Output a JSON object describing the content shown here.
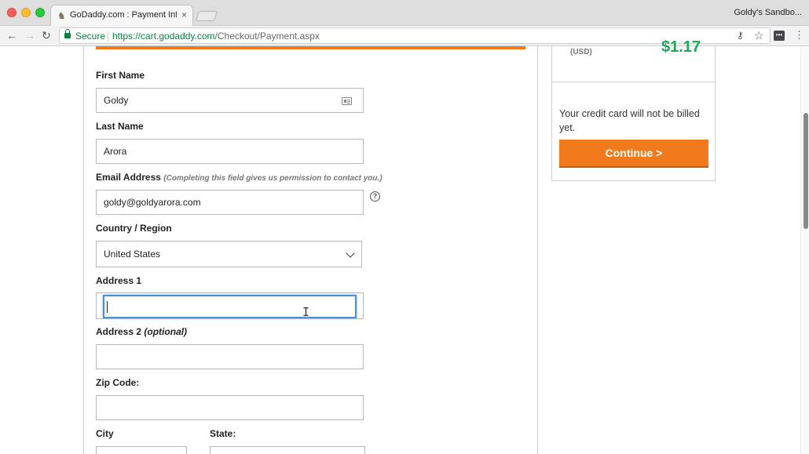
{
  "browser": {
    "tab_title": "GoDaddy.com : Payment Information",
    "tab_close": "×",
    "profile_name": "Goldy's Sandbo...",
    "secure_label": "Secure",
    "url_host": "https://cart.godaddy.com",
    "url_path": "/Checkout/Payment.aspx",
    "back_icon": "←",
    "forward_icon": "→",
    "reload_icon": "↻",
    "star_icon": "☆",
    "key_icon": "⚷",
    "menu_icon": "⋮",
    "ext_icon": "•••",
    "favicon": "♞"
  },
  "form": {
    "first_name_label": "First Name",
    "first_name_value": "Goldy",
    "last_name_label": "Last Name",
    "last_name_value": "Arora",
    "email_label": "Email Address",
    "email_hint": "(Completing this field gives us permission to contact you.)",
    "email_value": "goldy@goldyarora.com",
    "help_glyph": "?",
    "country_label": "Country / Region",
    "country_value": "United States",
    "address1_label": "Address 1",
    "address1_value": "",
    "address2_label": "Address 2",
    "address2_optional": "(optional)",
    "address2_value": "",
    "zip_label": "Zip Code:",
    "zip_value": "",
    "city_label": "City",
    "city_value": "",
    "state_label": "State:",
    "state_value": "",
    "ibeam_glyph": "I"
  },
  "summary": {
    "currency": "(USD)",
    "price": "$1.17",
    "billing_note": "Your credit card will not be billed yet.",
    "continue_label": "Continue >"
  },
  "colors": {
    "accent": "#f17a1d",
    "secure_green": "#0b8043",
    "price_green": "#1fa85e",
    "focus_blue": "#4a90d9"
  }
}
